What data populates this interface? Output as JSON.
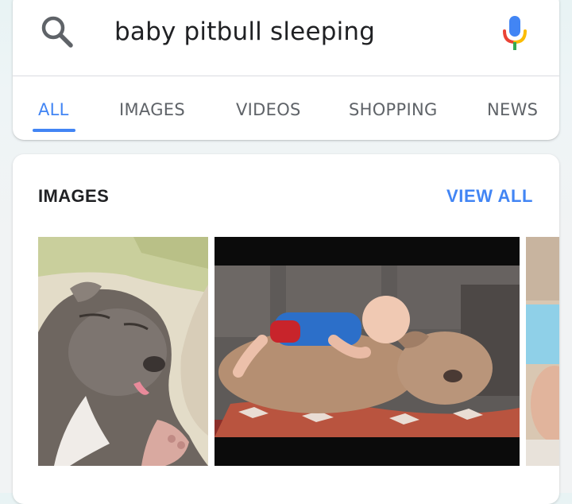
{
  "search": {
    "query": "baby pitbull sleeping"
  },
  "tabs": [
    {
      "label": "ALL",
      "active": true
    },
    {
      "label": "IMAGES"
    },
    {
      "label": "VIDEOS"
    },
    {
      "label": "SHOPPING"
    },
    {
      "label": "NEWS"
    }
  ],
  "images_section": {
    "title": "IMAGES",
    "view_all": "VIEW ALL"
  },
  "colors": {
    "accent": "#4285f4",
    "text": "#202124",
    "muted": "#5f6368"
  }
}
